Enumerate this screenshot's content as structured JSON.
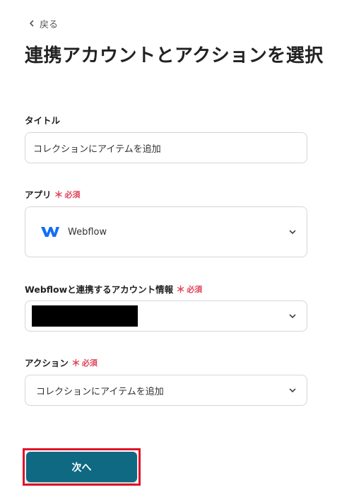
{
  "back": {
    "label": "戻る"
  },
  "page_title": "連携アカウントとアクションを選択",
  "required_label": "必須",
  "required_mark": "＊",
  "title_field": {
    "label": "タイトル",
    "value": "コレクションにアイテムを追加"
  },
  "app_field": {
    "label": "アプリ",
    "value": "Webflow",
    "icon": "webflow-logo-icon"
  },
  "account_field": {
    "label": "Webflowと連携するアカウント情報",
    "value_redacted": true
  },
  "action_field": {
    "label": "アクション",
    "value": "コレクションにアイテムを追加"
  },
  "next_button": {
    "label": "次へ"
  },
  "colors": {
    "primary": "#0f6983",
    "required": "#e0455a",
    "highlight": "#e0142a",
    "webflow": "#146ef5"
  }
}
